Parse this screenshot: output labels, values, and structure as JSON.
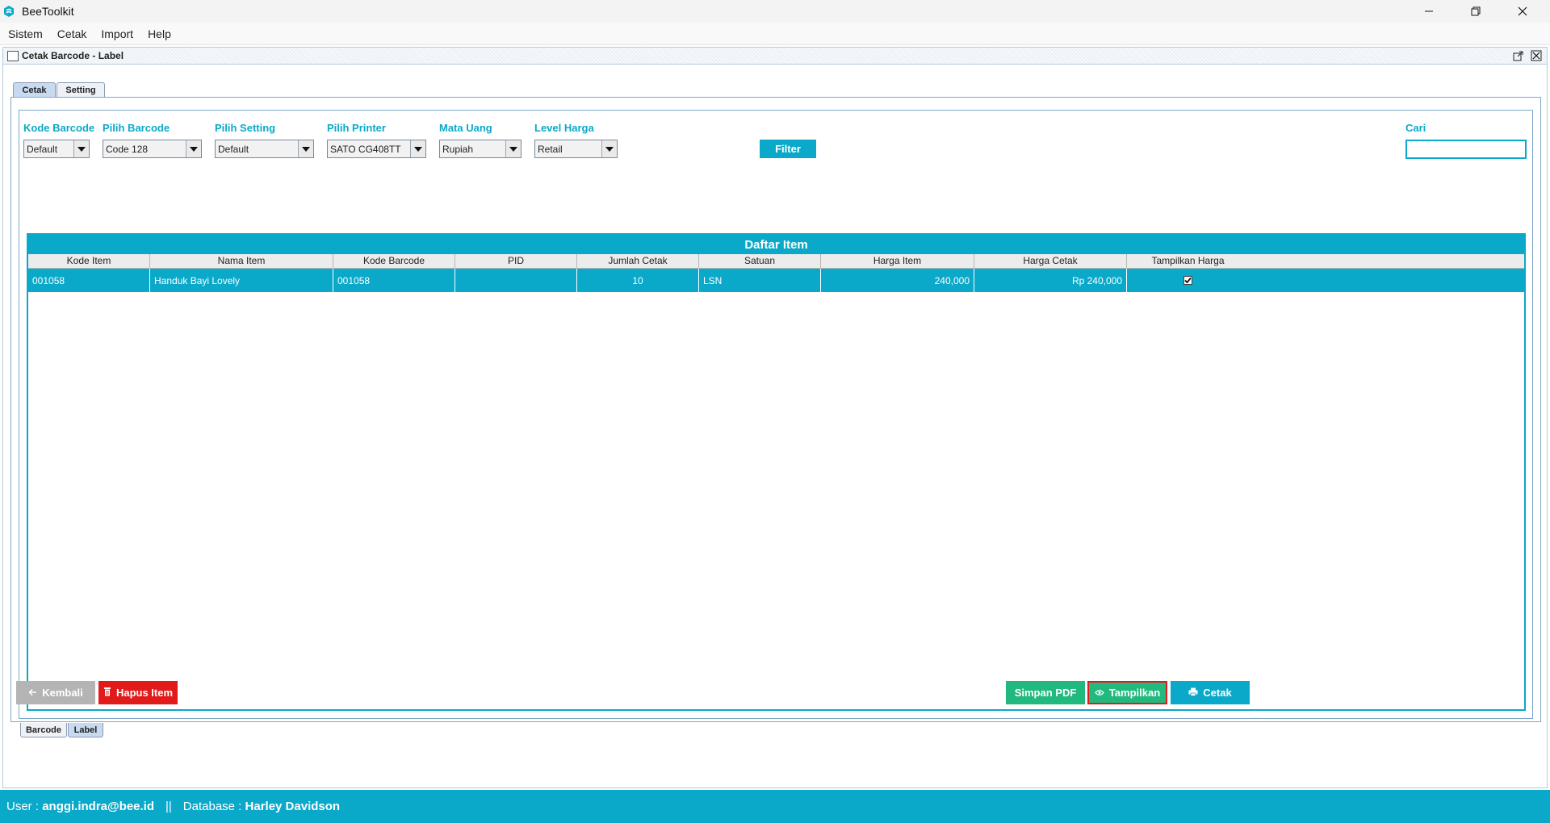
{
  "app": {
    "title": "BeeToolkit"
  },
  "menu": [
    "Sistem",
    "Cetak",
    "Import",
    "Help"
  ],
  "frame": {
    "title": "Cetak Barcode - Label"
  },
  "tabs": {
    "cetak": "Cetak",
    "setting": "Setting"
  },
  "filters": {
    "kode_barcode": {
      "label": "Kode Barcode",
      "value": "Default"
    },
    "pilih_barcode": {
      "label": "Pilih Barcode",
      "value": "Code 128"
    },
    "pilih_setting": {
      "label": "Pilih Setting",
      "value": "Default"
    },
    "pilih_printer": {
      "label": "Pilih Printer",
      "value": "SATO CG408TT"
    },
    "mata_uang": {
      "label": "Mata Uang",
      "value": "Rupiah"
    },
    "level_harga": {
      "label": "Level Harga",
      "value": "Retail"
    },
    "filter_button": "Filter",
    "cari_label": "Cari",
    "cari_value": ""
  },
  "table": {
    "title": "Daftar Item",
    "columns": [
      "Kode Item",
      "Nama Item",
      "Kode Barcode",
      "PID",
      "Jumlah Cetak",
      "Satuan",
      "Harga Item",
      "Harga Cetak",
      "Tampilkan Harga"
    ],
    "rows": [
      {
        "kode_item": "001058",
        "nama_item": "Handuk Bayi Lovely",
        "kode_barcode": "001058",
        "pid": "",
        "jumlah_cetak": "10",
        "satuan": "LSN",
        "harga_item": "240,000",
        "harga_cetak": "Rp 240,000",
        "tampilkan_harga": true
      }
    ]
  },
  "bottom_tabs": {
    "barcode": "Barcode",
    "label": "Label"
  },
  "buttons": {
    "kembali": "Kembali",
    "hapus": "Hapus Item",
    "simpan_pdf": "Simpan PDF",
    "tampilkan": "Tampilkan",
    "cetak": "Cetak"
  },
  "status": {
    "user_label": "User :",
    "user": "anggi.indra@bee.id",
    "separator": "||",
    "db_label": "Database :",
    "db": "Harley Davidson"
  },
  "colors": {
    "accent": "#0aa9c9",
    "green": "#22b97e",
    "red": "#e11a1a",
    "grey": "#b4b4b4"
  },
  "icons": {
    "app": "bee-logo-icon",
    "kembali": "arrow-left-icon",
    "hapus": "trash-icon",
    "tampilkan": "eye-icon",
    "cetak": "printer-icon"
  }
}
